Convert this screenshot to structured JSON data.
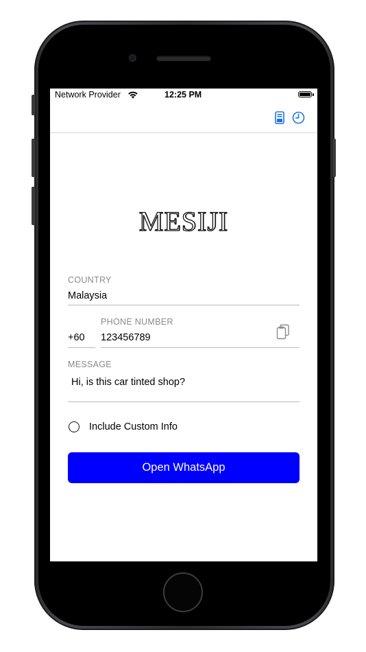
{
  "status_bar": {
    "carrier": "Network Provider",
    "time": "12:25 PM"
  },
  "nav_bar": {
    "icons": [
      "card-icon",
      "history-clock-icon"
    ],
    "accent_color": "#1a73e8"
  },
  "app": {
    "logo": "MESIJI"
  },
  "form": {
    "country": {
      "label": "COUNTRY",
      "value": "Malaysia"
    },
    "phone": {
      "code": "+60",
      "label": "PHONE NUMBER",
      "value": "123456789"
    },
    "message": {
      "label": "MESSAGE",
      "value": "Hi, is this car tinted shop?"
    },
    "custom_info": {
      "label": "Include Custom Info",
      "checked": false
    },
    "submit": {
      "label": "Open WhatsApp",
      "color": "#0000ff"
    }
  }
}
